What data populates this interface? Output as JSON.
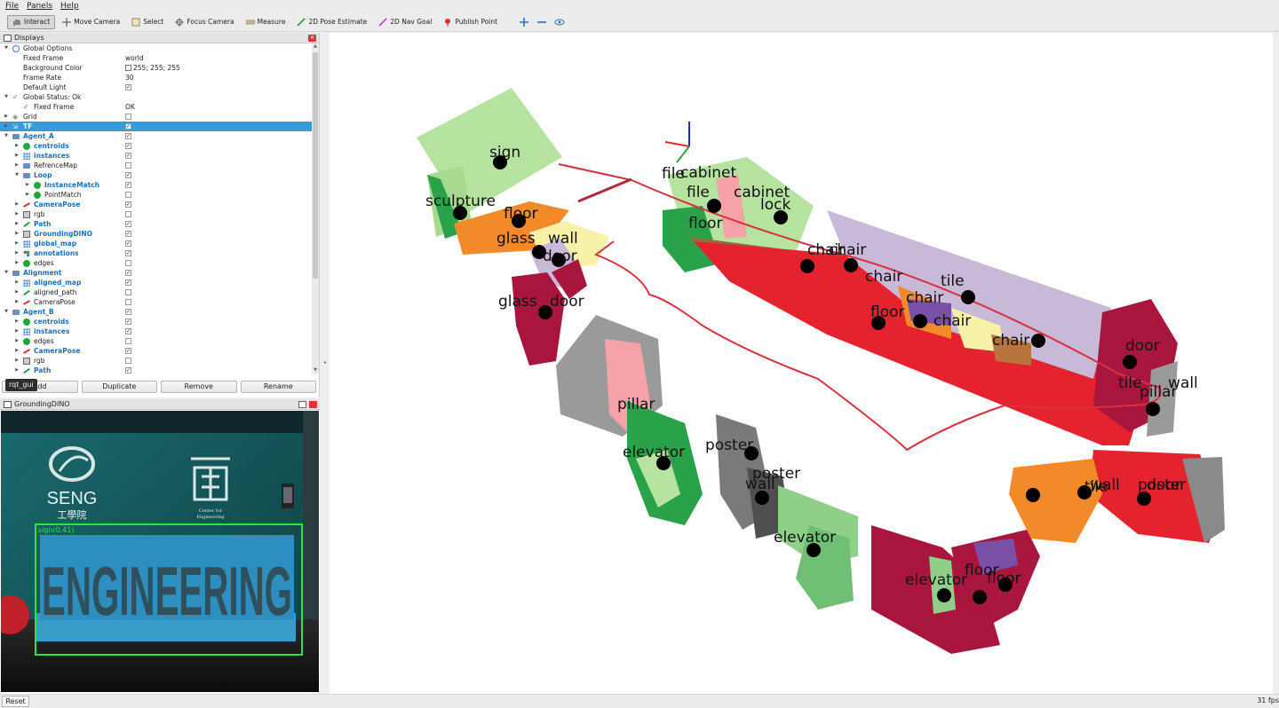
{
  "menu": [
    "File",
    "Panels",
    "Help"
  ],
  "toolbar": {
    "tools": [
      {
        "label": "Interact",
        "icon": "hand-icon"
      },
      {
        "label": "Move Camera",
        "icon": "move-camera-icon"
      },
      {
        "label": "Select",
        "icon": "select-icon"
      },
      {
        "label": "Focus Camera",
        "icon": "focus-camera-icon"
      },
      {
        "label": "Measure",
        "icon": "ruler-icon"
      },
      {
        "label": "2D Pose Estimate",
        "icon": "pose-estimate-icon"
      },
      {
        "label": "2D Nav Goal",
        "icon": "nav-goal-icon"
      },
      {
        "label": "Publish Point",
        "icon": "map-pin-icon"
      }
    ]
  },
  "displays": {
    "title": "Displays",
    "rows": [
      {
        "label": "Global Options",
        "depth": 0,
        "expanded": true,
        "icon": "globe"
      },
      {
        "label": "Fixed Frame",
        "depth": 1,
        "value": "world"
      },
      {
        "label": "Background Color",
        "depth": 1,
        "value": "255; 255; 255",
        "swatch": true
      },
      {
        "label": "Frame Rate",
        "depth": 1,
        "value": "30"
      },
      {
        "label": "Default Light",
        "depth": 1,
        "checked": true
      },
      {
        "label": "Global Status: Ok",
        "depth": 0,
        "expanded": true,
        "icon": "check"
      },
      {
        "label": "Fixed Frame",
        "depth": 1,
        "value": "OK",
        "icon": "check"
      },
      {
        "label": "Grid",
        "depth": 0,
        "collapsed": true,
        "icon": "grid",
        "checked": false
      },
      {
        "label": "TF",
        "depth": 0,
        "collapsed": true,
        "icon": "tf",
        "checked": true,
        "blue": true,
        "selected": true
      },
      {
        "label": "Agent_A",
        "depth": 0,
        "expanded": true,
        "icon": "folder",
        "checked": true,
        "blue": true
      },
      {
        "label": "centroids",
        "depth": 1,
        "collapsed": true,
        "icon": "marker",
        "checked": true,
        "blue": true
      },
      {
        "label": "instances",
        "depth": 1,
        "collapsed": true,
        "icon": "cloud",
        "checked": true,
        "blue": true
      },
      {
        "label": "RefrenceMap",
        "depth": 1,
        "collapsed": true,
        "icon": "folder",
        "checked": false
      },
      {
        "label": "Loop",
        "depth": 1,
        "expanded": true,
        "icon": "folder",
        "checked": true,
        "blue": true
      },
      {
        "label": "InstanceMatch",
        "depth": 2,
        "collapsed": true,
        "icon": "marker",
        "checked": true,
        "blue": true
      },
      {
        "label": "PointMatch",
        "depth": 2,
        "collapsed": true,
        "icon": "marker",
        "checked": false
      },
      {
        "label": "CameraPose",
        "depth": 1,
        "collapsed": true,
        "icon": "pose",
        "checked": true,
        "blue": true
      },
      {
        "label": "rgb",
        "depth": 1,
        "collapsed": true,
        "icon": "image",
        "checked": false
      },
      {
        "label": "Path",
        "depth": 1,
        "collapsed": true,
        "icon": "path",
        "checked": true,
        "blue": true
      },
      {
        "label": "GroundingDINO",
        "depth": 1,
        "collapsed": true,
        "icon": "image",
        "checked": true,
        "blue": true
      },
      {
        "label": "global_map",
        "depth": 1,
        "collapsed": true,
        "icon": "cloud",
        "checked": true,
        "blue": true
      },
      {
        "label": "annotations",
        "depth": 1,
        "collapsed": true,
        "icon": "markerarray",
        "checked": true,
        "blue": true
      },
      {
        "label": "edges",
        "depth": 1,
        "collapsed": true,
        "icon": "marker",
        "checked": false
      },
      {
        "label": "Alignment",
        "depth": 0,
        "expanded": true,
        "icon": "folder",
        "checked": true,
        "blue": true
      },
      {
        "label": "aligned_map",
        "depth": 1,
        "collapsed": true,
        "icon": "cloud",
        "checked": true,
        "blue": true
      },
      {
        "label": "aligned_path",
        "depth": 1,
        "collapsed": true,
        "icon": "path",
        "checked": false
      },
      {
        "label": "CameraPose",
        "depth": 1,
        "collapsed": true,
        "icon": "pose",
        "checked": false
      },
      {
        "label": "Agent_B",
        "depth": 0,
        "expanded": true,
        "icon": "folder",
        "checked": true,
        "blue": true
      },
      {
        "label": "centroids",
        "depth": 1,
        "collapsed": true,
        "icon": "marker",
        "checked": true,
        "blue": true
      },
      {
        "label": "instances",
        "depth": 1,
        "collapsed": true,
        "icon": "cloud",
        "checked": true,
        "blue": true
      },
      {
        "label": "edges",
        "depth": 1,
        "collapsed": true,
        "icon": "marker",
        "checked": false
      },
      {
        "label": "CameraPose",
        "depth": 1,
        "collapsed": true,
        "icon": "pose",
        "checked": true,
        "blue": true
      },
      {
        "label": "rgb",
        "depth": 1,
        "collapsed": true,
        "icon": "image",
        "checked": false
      },
      {
        "label": "Path",
        "depth": 1,
        "collapsed": true,
        "icon": "path",
        "checked": true,
        "blue": true
      }
    ],
    "buttons": {
      "add": "Add",
      "duplicate": "Duplicate",
      "remove": "Remove",
      "rename": "Rename"
    },
    "tooltip": "rqt_gui"
  },
  "grounding_panel": {
    "title": "GroundingDINO",
    "camera": {
      "wall_logo_main": "SENG",
      "wall_logo_sub": "工學院",
      "wall_center_text_1": "Center for",
      "wall_center_text_2": "Engineering",
      "sign_text": "ENGINEERING",
      "detection_label": "sign(0.41)"
    }
  },
  "view3d": {
    "labels": [
      "sign",
      "sculpture",
      "floor",
      "glass",
      "wall",
      "door",
      "glass",
      "door",
      "file",
      "cabinet",
      "file",
      "cabinet",
      "floor",
      "lock",
      "chair",
      "chair",
      "chair",
      "tile",
      "chair",
      "floor",
      "chair",
      "chair",
      "door",
      "tile",
      "pillar",
      "wall",
      "pillar",
      "elevator",
      "poster",
      "poster",
      "wall",
      "elevator",
      "tile",
      "wall",
      "door",
      "poster",
      "elevator",
      "floor",
      "floor"
    ]
  },
  "status": {
    "reset": "Reset",
    "fps": "31 fps"
  },
  "colors": {
    "selection": "#3a9bd6",
    "path": "#d8303e",
    "accent_blue": "#1f6fb5"
  }
}
